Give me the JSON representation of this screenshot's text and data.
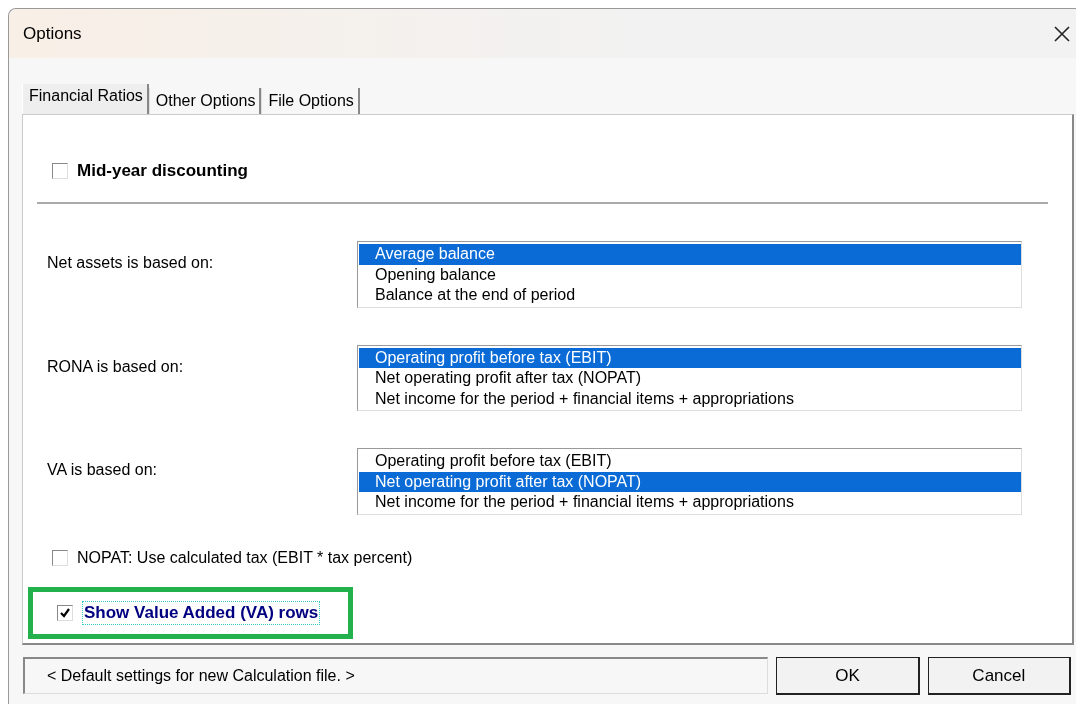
{
  "window": {
    "title": "Options"
  },
  "tabs": [
    {
      "label": "Financial Ratios",
      "selected": true
    },
    {
      "label": "Other Options",
      "selected": false
    },
    {
      "label": "File Options",
      "selected": false
    }
  ],
  "mid_year_discounting": {
    "label": "Mid-year discounting",
    "checked": false
  },
  "selectors": [
    {
      "label": "Net assets is based on:",
      "options": [
        {
          "label": "Average balance",
          "selected": true
        },
        {
          "label": "Opening balance",
          "selected": false
        },
        {
          "label": "Balance at the end of period",
          "selected": false
        }
      ]
    },
    {
      "label": "RONA is based on:",
      "options": [
        {
          "label": "Operating profit before tax (EBIT)",
          "selected": true
        },
        {
          "label": "Net operating profit after tax (NOPAT)",
          "selected": false
        },
        {
          "label": "Net income for the period + financial items + appropriations",
          "selected": false
        }
      ]
    },
    {
      "label": "VA is based on:",
      "options": [
        {
          "label": "Operating profit before tax (EBIT)",
          "selected": false
        },
        {
          "label": "Net operating profit after tax (NOPAT)",
          "selected": true
        },
        {
          "label": "Net income for the period + financial items + appropriations",
          "selected": false
        }
      ]
    }
  ],
  "nopat_checkbox": {
    "label": "NOPAT: Use calculated tax (EBIT * tax percent)",
    "checked": false
  },
  "show_va_checkbox": {
    "label": "Show Value Added (VA) rows",
    "checked": true,
    "focused": true,
    "highlighted": true
  },
  "status": "< Default settings for new Calculation file. >",
  "buttons": [
    "OK",
    "Cancel"
  ]
}
